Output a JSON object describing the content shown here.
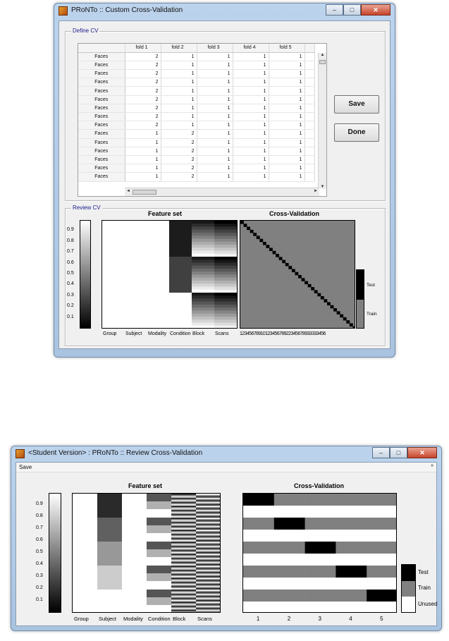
{
  "window1": {
    "title": "PRoNTo :: Custom Cross-Validation",
    "define_panel": "Define CV",
    "review_panel": "Review CV",
    "columns": [
      "fold 1",
      "fold 2",
      "fold 3",
      "fold 4",
      "fold 5"
    ],
    "rows": [
      {
        "label": "Faces",
        "values": [
          2,
          1,
          1,
          1,
          1
        ]
      },
      {
        "label": "Faces",
        "values": [
          2,
          1,
          1,
          1,
          1
        ]
      },
      {
        "label": "Faces",
        "values": [
          2,
          1,
          1,
          1,
          1
        ]
      },
      {
        "label": "Faces",
        "values": [
          2,
          1,
          1,
          1,
          1
        ]
      },
      {
        "label": "Faces",
        "values": [
          2,
          1,
          1,
          1,
          1
        ]
      },
      {
        "label": "Faces",
        "values": [
          2,
          1,
          1,
          1,
          1
        ]
      },
      {
        "label": "Faces",
        "values": [
          2,
          1,
          1,
          1,
          1
        ]
      },
      {
        "label": "Faces",
        "values": [
          2,
          1,
          1,
          1,
          1
        ]
      },
      {
        "label": "Faces",
        "values": [
          2,
          1,
          1,
          1,
          1
        ]
      },
      {
        "label": "Faces",
        "values": [
          1,
          2,
          1,
          1,
          1
        ]
      },
      {
        "label": "Faces",
        "values": [
          1,
          2,
          1,
          1,
          1
        ]
      },
      {
        "label": "Faces",
        "values": [
          1,
          2,
          1,
          1,
          1
        ]
      },
      {
        "label": "Faces",
        "values": [
          1,
          2,
          1,
          1,
          1
        ]
      },
      {
        "label": "Faces",
        "values": [
          1,
          2,
          1,
          1,
          1
        ]
      },
      {
        "label": "Faces",
        "values": [
          1,
          2,
          1,
          1,
          1
        ]
      }
    ],
    "save_label": "Save",
    "done_label": "Done",
    "feature_title": "Feature set",
    "cv_title": "Cross-Validation",
    "colorbar_ticks": [
      "0.9",
      "0.8",
      "0.7",
      "0.6",
      "0.5",
      "0.4",
      "0.3",
      "0.2",
      "0.1"
    ],
    "feature_xlabels": [
      "Group",
      "Subject",
      "Modality",
      "Condition",
      "Block",
      "Scans"
    ],
    "cv_xticks": "1234567891012345678922345678933333456",
    "legend_test": "Test",
    "legend_train": "Train"
  },
  "window2": {
    "title": "<Student Version> : PRoNTo :: Review Cross-Validation",
    "menu_save": "Save",
    "feature_title": "Feature set",
    "cv_title": "Cross-Validation",
    "colorbar_ticks": [
      "0.9",
      "0.8",
      "0.7",
      "0.6",
      "0.5",
      "0.4",
      "0.3",
      "0.2",
      "0.1"
    ],
    "feature_xlabels": [
      "Group",
      "Subject",
      "Modality",
      "Condition",
      "Block",
      "Scans"
    ],
    "cv_xticks": [
      "1",
      "2",
      "3",
      "4",
      "5"
    ],
    "legend_test": "Test",
    "legend_train": "Train",
    "legend_unused": "Unused"
  },
  "colors": {
    "test": "#000000",
    "train": "#808080",
    "unused": "#ffffff",
    "title_text": "#1a1a8c"
  }
}
